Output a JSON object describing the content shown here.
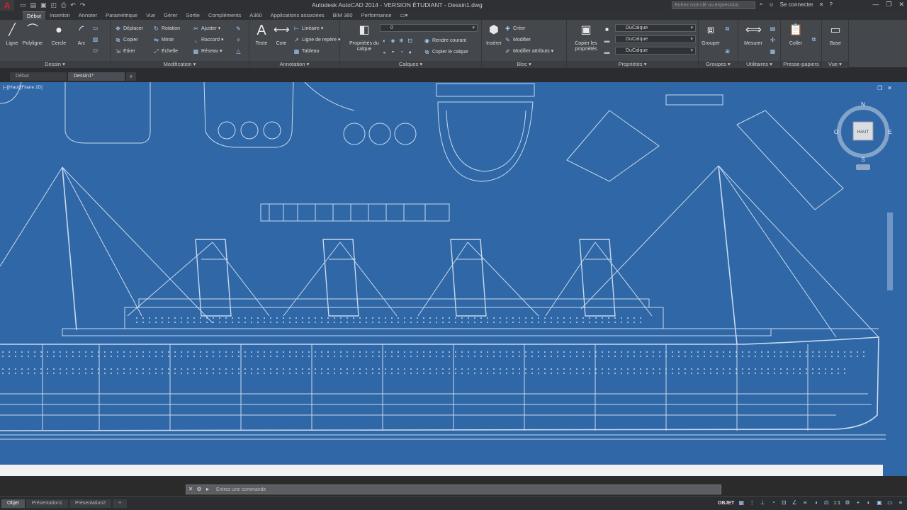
{
  "titlebar": {
    "title": "Autodesk AutoCAD 2014 - VERSION ÉTUDIANT - Dessin1.dwg",
    "search_placeholder": "Entrez mot-clé ou expression",
    "signin": "Se connecter",
    "qat_icons": [
      "new-icon",
      "open-icon",
      "save-icon",
      "saveas-icon",
      "print-icon",
      "undo-icon",
      "redo-icon"
    ]
  },
  "ribbon_tabs": [
    "Début",
    "Insertion",
    "Annoter",
    "Paramétrique",
    "Vue",
    "Gérer",
    "Sortie",
    "Compléments",
    "A360",
    "Applications associées",
    "BIM 360",
    "Performance"
  ],
  "ribbon": {
    "dessin": {
      "label": "Dessin ▾",
      "tools": [
        "Ligne",
        "Polyligne",
        "Cercle",
        "Arc"
      ]
    },
    "modification": {
      "label": "Modification ▾",
      "tools": [
        "Déplacer",
        "Rotation",
        "Ajuster ▾",
        "Copier",
        "Miroir",
        "Raccord ▾",
        "Étirer",
        "Échelle",
        "Réseau ▾"
      ]
    },
    "annotation": {
      "label": "Annotation ▾",
      "big": [
        "Texte",
        "Cote"
      ],
      "small": [
        "Linéaire ▾",
        "Ligne de repère ▾",
        "Tableau"
      ]
    },
    "calques": {
      "label": "Calques ▾",
      "big": "Propriétés du calque",
      "layer_value": "0",
      "small": [
        "Rendre courant",
        "Copier le calque"
      ]
    },
    "bloc": {
      "label": "Bloc ▾",
      "big": "Insérer",
      "small": [
        "Créer",
        "Modifier",
        "Modifier attributs ▾"
      ]
    },
    "proprietes": {
      "label": "Propriétés ▾",
      "big": "Copier les propriétés",
      "values": [
        "DuCalque",
        "DuCalque",
        "DuCalque"
      ]
    },
    "groupes": {
      "label": "Groupes ▾",
      "big": "Grouper"
    },
    "utilitaires": {
      "label": "Utilitaires ▾",
      "big": "Mesurer"
    },
    "presse_papiers": {
      "label": "Presse-papiers",
      "big": "Coller"
    },
    "vue": {
      "label": "Vue ▾",
      "big": "Base"
    }
  },
  "doc_tabs": [
    "Début",
    "Dessin1*"
  ],
  "viewport_label": "[–][Haut][Filaire 2D]",
  "viewcube": {
    "north": "N",
    "south": "S",
    "east": "E",
    "west": "O",
    "face": "HAUT"
  },
  "command_line": {
    "prompt": "Entrez une commande"
  },
  "layout_tabs": [
    "Objet",
    "Présentation1",
    "Présentation2"
  ],
  "status": {
    "mode": "OBJET",
    "scale": "1:1"
  },
  "colors": {
    "blueprint": "#2f67a7",
    "ribbon": "#44474c",
    "line": "#e4eef9"
  }
}
